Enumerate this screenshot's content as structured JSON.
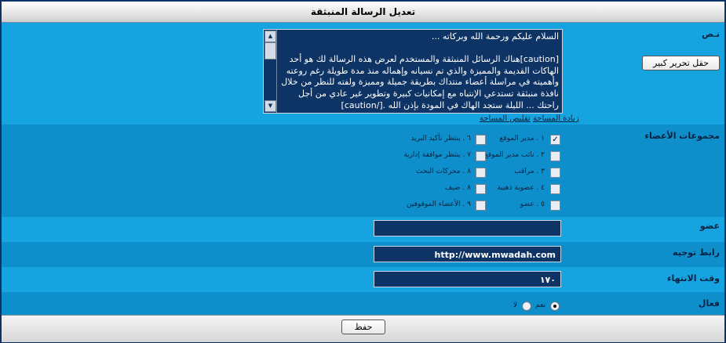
{
  "title": "تعديل الرسالة المنبثقة",
  "text_section": {
    "label": "نـص",
    "message": "السلام عليكم ورحمة الله وبركاته ...\n\n[caution]هناك الرسائل المنبثقة والمستخدم لعرض هذه الرسالة لك هو أحد الهاكات القديمة والمميزة والذي تم نسيانه وإهماله منذ مدة طويلة رغم روعته وأهميته في مراسلة أعضاء منتداك بطريقة جميلة ومميزة ولفته للنظر من خلال نافذة منبثقة تستدعي الإنتباه مع إمكانيات كبيرة وتطوير غير عادي من أجل راحتك ... الليلة ستجد الهاك في المودة بإذن الله .[/caution]",
    "big_editor_button": "حقل تحرير كبير",
    "increase_area": "زيادة المساحة",
    "decrease_area": "تقليص المساحة"
  },
  "groups_section": {
    "label": "مجموعات الأعضاء",
    "groups": [
      {
        "label": "١ . مدير الموقع",
        "checked": true
      },
      {
        "label": "٢ . نائب مدير الموقع",
        "checked": false
      },
      {
        "label": "٣ . مراقب",
        "checked": false
      },
      {
        "label": "٤ . عضوية ذهبية",
        "checked": false
      },
      {
        "label": "٥ . عضو",
        "checked": false
      },
      {
        "label": "٦ . ينتظر تأكيد البريد",
        "checked": false
      },
      {
        "label": "٧ . ينتظر موافقة إدارية",
        "checked": false
      },
      {
        "label": "٨ . محركات البحث",
        "checked": false
      },
      {
        "label": "٨ . ضيف",
        "checked": false
      },
      {
        "label": "٩ . الأعضاء الموقوفين",
        "checked": false
      }
    ]
  },
  "member_field": {
    "label": "عضو",
    "value": ""
  },
  "redirect_link": {
    "label": "رابط توجيه",
    "value": "http://www.mwadah.com"
  },
  "end_time": {
    "label": "وقت الانتهاء",
    "value": "١٧٠"
  },
  "active": {
    "label": "فعال",
    "yes_label": "نعم",
    "no_label": "لا",
    "selected": "yes"
  },
  "save_button": "حفظ",
  "colors": {
    "light_row": "#16a4e0",
    "dark_row": "#0e8fcb",
    "field_bg": "#0e3466",
    "border": "#0b3a78"
  }
}
